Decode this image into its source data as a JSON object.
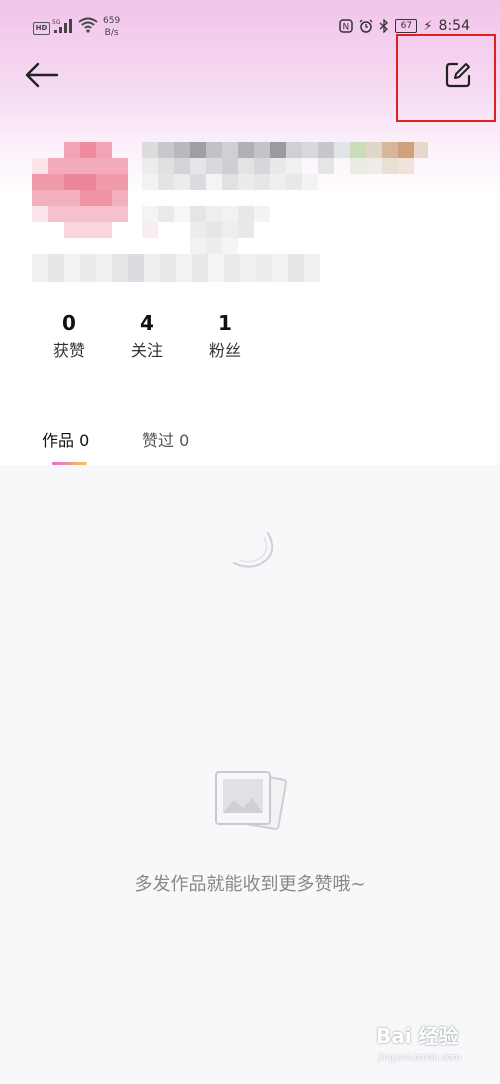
{
  "status_bar": {
    "hd": "HD",
    "net": "5G",
    "speed_value": "659",
    "speed_unit": "B/s",
    "nfc_icon": "nfc-icon",
    "alarm_icon": "alarm-icon",
    "bluetooth_icon": "bluetooth-icon",
    "battery": "67",
    "time": "8:54"
  },
  "header": {
    "back_icon": "arrow-left-icon",
    "edit_icon": "edit-icon",
    "highlight_color": "#e02020"
  },
  "stats": [
    {
      "value": "0",
      "label": "获赞"
    },
    {
      "value": "4",
      "label": "关注"
    },
    {
      "value": "1",
      "label": "粉丝"
    }
  ],
  "tabs": {
    "works": "作品 0",
    "liked": "赞过 0"
  },
  "empty_state": {
    "icon": "image-placeholder-icon",
    "text": "多发作品就能收到更多赞哦~"
  },
  "watermark": {
    "main": "Bai 经验",
    "sub": "jingyan.baidu.com"
  },
  "colors": {
    "accent_gradient_start": "#e86ad6",
    "accent_gradient_end": "#f8c84a",
    "header_pink": "#f2c4ec"
  }
}
